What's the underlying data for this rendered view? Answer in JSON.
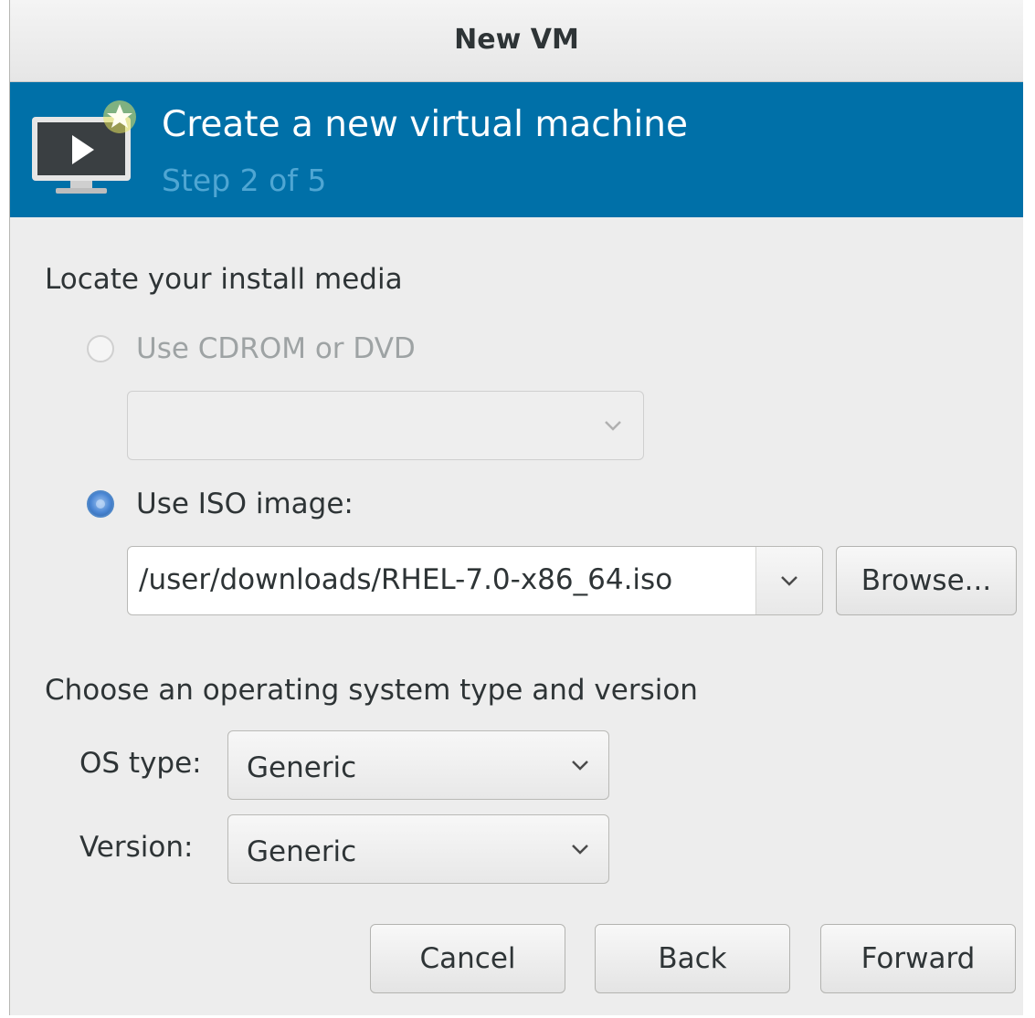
{
  "window": {
    "title": "New VM"
  },
  "banner": {
    "title": "Create a new virtual machine",
    "step": "Step 2 of 5",
    "icon": "vm-monitor-play-icon"
  },
  "install_media": {
    "heading": "Locate your install media",
    "cdrom_option": {
      "label": "Use CDROM or DVD",
      "selected": false,
      "enabled": false,
      "value": ""
    },
    "iso_option": {
      "label": "Use ISO image:",
      "selected": true,
      "enabled": true,
      "value": "/user/downloads/RHEL-7.0-x86_64.iso"
    },
    "browse_label": "Browse..."
  },
  "os": {
    "heading": "Choose an operating system type and version",
    "os_type_label": "OS type:",
    "os_type_value": "Generic",
    "version_label": "Version:",
    "version_value": "Generic"
  },
  "actions": {
    "cancel": "Cancel",
    "back": "Back",
    "forward": "Forward"
  },
  "colors": {
    "banner": "#0070a8",
    "banner_step": "#4fa6d3",
    "window_bg": "#ededed",
    "radio_selected": "#4a86d4"
  }
}
